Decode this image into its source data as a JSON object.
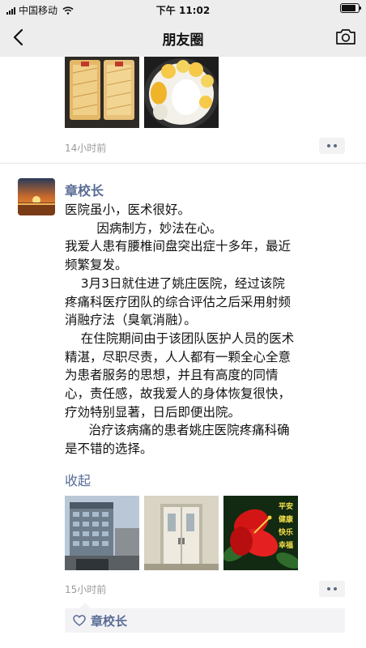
{
  "status_bar": {
    "carrier": "中国移动",
    "time": "下午 11:02"
  },
  "nav": {
    "title": "朋友圈",
    "back_icon": "chevron-left-icon",
    "camera_icon": "camera-icon"
  },
  "post_previous": {
    "time": "14小时前",
    "images": [
      "toast-slices-photo",
      "fruit-plate-photo"
    ]
  },
  "post": {
    "author": "章校长",
    "text_lines": [
      "医院虽小，医术很好。",
      "        因病制方，妙法在心。",
      "我爱人患有腰椎间盘突出症十多年，最近",
      "频繁复发。",
      "    3月3日就住进了姚庄医院，经过该院",
      "疼痛科医疗团队的综合评估之后采用射频",
      "消融疗法（臭氧消融）。",
      "    在住院期间由于该团队医护人员的医术",
      "精湛，尽职尽责，人人都有一颗全心全意",
      "为患者服务的思想，并且有高度的同情",
      "心，责任感，故我爱人的身体恢复很快，",
      "疗効特别显著，日后即便出院。",
      "      治疗该病痛的患者姚庄医院疼痛科确",
      "是不错的选择。"
    ],
    "collapse_label": "收起",
    "images": [
      "hospital-building-photo",
      "ward-door-photo",
      "red-flower-photo"
    ],
    "flower_caption": [
      "平安",
      "健康",
      "快乐",
      "幸福"
    ],
    "time": "15小时前",
    "likes": {
      "icon": "heart-icon",
      "names": "章校长"
    }
  },
  "colors": {
    "link": "#576b95",
    "bar_bg": "#ededed",
    "time_text": "#9a9a9a"
  }
}
